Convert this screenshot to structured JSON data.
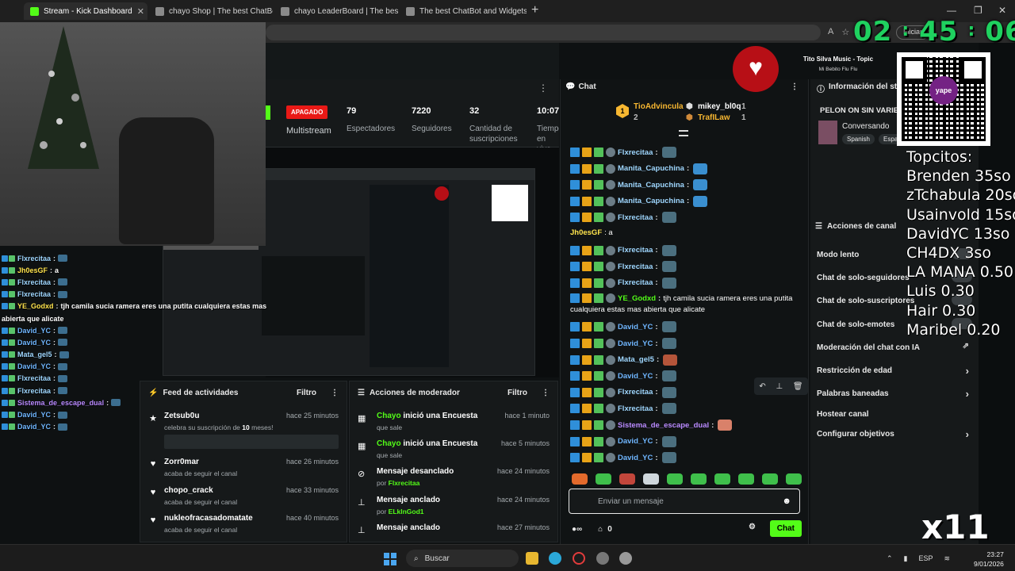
{
  "browser": {
    "tabs": [
      {
        "title": "Stream - Kick Dashboard",
        "active": true
      },
      {
        "title": "chayo Shop | The best ChatBot an"
      },
      {
        "title": "chayo LeaderBoard | The best Chat"
      },
      {
        "title": "The best ChatBot and Widgets for"
      }
    ],
    "signin_label": "Iniciar"
  },
  "clock": {
    "h": "02",
    "m": "45",
    "s": "06"
  },
  "stats": {
    "status": "APAGADO",
    "multistream": "Multistream",
    "items": [
      {
        "value": "79",
        "label": "Espectadores"
      },
      {
        "value": "7220",
        "label": "Seguidores"
      },
      {
        "value": "32",
        "label": "Cantidad de suscripciones"
      },
      {
        "value": "10:07",
        "label": "Tiempo en vivo"
      }
    ]
  },
  "overlay_chat": [
    {
      "user": "Flxrecitaa",
      "color": "#9fd7ff",
      "msg": ""
    },
    {
      "user": "Jh0esGF",
      "color": "#ffe44d",
      "msg": "a"
    },
    {
      "user": "Flxrecitaa",
      "color": "#9fd7ff",
      "msg": ""
    },
    {
      "user": "Flxrecitaa",
      "color": "#9fd7ff",
      "msg": ""
    },
    {
      "user": "YE_Godxd",
      "color": "#ffe44d",
      "msg": "tjh camila sucia ramera eres una putita cualquiera estas mas"
    },
    {
      "user": "",
      "color": "#fff",
      "msg": "abierta que alicate"
    },
    {
      "user": "David_YC",
      "color": "#6fb6ff",
      "msg": ""
    },
    {
      "user": "David_YC",
      "color": "#6fb6ff",
      "msg": ""
    },
    {
      "user": "Mata_gel5",
      "color": "#9fd7ff",
      "msg": ""
    },
    {
      "user": "David_YC",
      "color": "#6fb6ff",
      "msg": ""
    },
    {
      "user": "Flxrecitaa",
      "color": "#9fd7ff",
      "msg": ""
    },
    {
      "user": "Flxrecitaa",
      "color": "#9fd7ff",
      "msg": ""
    },
    {
      "user": "Sistema_de_escape_dual",
      "color": "#b98aff",
      "msg": ""
    },
    {
      "user": "David_YC",
      "color": "#6fb6ff",
      "msg": ""
    },
    {
      "user": "David_YC",
      "color": "#6fb6ff",
      "msg": ""
    }
  ],
  "activity": {
    "title": "Feed de actividades",
    "filter": "Filtro",
    "items": [
      {
        "user": "Zetsub0u",
        "time": "hace 25 minutos",
        "desc_pre": "celebra su suscripción de ",
        "desc_num": "10",
        "desc_post": " meses!",
        "icon": "★"
      },
      {
        "user": "Zorr0mar",
        "time": "hace 26 minutos",
        "desc": "acaba de seguir el canal",
        "icon": "♥"
      },
      {
        "user": "chopo_crack",
        "time": "hace 33 minutos",
        "desc": "acaba de seguir el canal",
        "icon": "♥"
      },
      {
        "user": "nukleofracasadomatate",
        "time": "hace 40 minutos",
        "desc": "acaba de seguir el canal",
        "icon": "♥"
      }
    ]
  },
  "modactions": {
    "title": "Acciones de moderador",
    "filter": "Filtro",
    "items": [
      {
        "who": "Chayo",
        "action": " inició una Encuesta",
        "time": "hace 1 minuto",
        "sub": "que sale",
        "by": ""
      },
      {
        "who": "Chayo",
        "action": " inició una Encuesta",
        "time": "hace 5 minutos",
        "sub": "que sale",
        "by": ""
      },
      {
        "who": "",
        "action": "Mensaje desanclado",
        "time": "hace 24 minutos",
        "sub": "por ",
        "by": "Flxrecitaa"
      },
      {
        "who": "",
        "action": "Mensaje anclado",
        "time": "hace 24 minutos",
        "sub": "por ",
        "by": "ELkInGod1"
      },
      {
        "who": "",
        "action": "Mensaje anclado",
        "time": "hace 27 minutos",
        "sub": "",
        "by": ""
      }
    ]
  },
  "chat": {
    "title": "Chat",
    "podium": {
      "first": {
        "name": "TioAdvincula",
        "rank": "1",
        "count": "2"
      },
      "second": {
        "name": "mikey_bl0q",
        "count": "1"
      },
      "third": {
        "name": "TrafILaw",
        "count": "1"
      }
    },
    "messages": [
      {
        "user": "Flxrecitaa",
        "color": "#9fd7ff",
        "text": "",
        "emote": "#4b6f7f",
        "badges": true
      },
      {
        "user": "Manita_Capuchina",
        "color": "#9fd7ff",
        "text": "",
        "emote": "#3a8fd0",
        "badges": true
      },
      {
        "user": "Manita_Capuchina",
        "color": "#9fd7ff",
        "text": "",
        "emote": "#3a8fd0",
        "badges": true
      },
      {
        "user": "Manita_Capuchina",
        "color": "#9fd7ff",
        "text": "",
        "emote": "#3a8fd0",
        "badges": true
      },
      {
        "user": "Flxrecitaa",
        "color": "#9fd7ff",
        "text": "",
        "emote": "#4b6f7f",
        "badges": true
      },
      {
        "user": "Jh0esGF",
        "color": "#ffe44d",
        "text": ": a",
        "emote": "",
        "badges": false
      },
      {
        "user": "Flxrecitaa",
        "color": "#9fd7ff",
        "text": "",
        "emote": "#4b6f7f",
        "badges": true
      },
      {
        "user": "Flxrecitaa",
        "color": "#9fd7ff",
        "text": "",
        "emote": "#4b6f7f",
        "badges": true
      },
      {
        "user": "Flxrecitaa",
        "color": "#9fd7ff",
        "text": "",
        "emote": "#4b6f7f",
        "badges": true
      },
      {
        "user": "YE_Godxd",
        "color": "#53fc18",
        "text": "tjh camila sucia ramera eres una putita",
        "emote": "",
        "badges": true
      },
      {
        "user": "",
        "color": "#fff",
        "text": "cualquiera estas mas abierta que alicate",
        "emote": "",
        "badges": false
      },
      {
        "user": "David_YC",
        "color": "#6fb6ff",
        "text": "",
        "emote": "#4b6f7f",
        "badges": true
      },
      {
        "user": "David_YC",
        "color": "#6fb6ff",
        "text": "",
        "emote": "#4b6f7f",
        "badges": true
      },
      {
        "user": "Mata_gel5",
        "color": "#9fd7ff",
        "text": "",
        "emote": "#b5553a",
        "badges": true
      },
      {
        "user": "David_YC",
        "color": "#6fb6ff",
        "text": "",
        "emote": "#4b6f7f",
        "badges": true
      },
      {
        "user": "Flxrecitaa",
        "color": "#9fd7ff",
        "text": "",
        "emote": "#4b6f7f",
        "badges": true
      },
      {
        "user": "Flxrecitaa",
        "color": "#9fd7ff",
        "text": "",
        "emote": "#4b6f7f",
        "badges": true
      },
      {
        "user": "Sistema_de_escape_dual",
        "color": "#b98aff",
        "text": "",
        "emote": "#d9816a",
        "badges": true
      },
      {
        "user": "David_YC",
        "color": "#6fb6ff",
        "text": "",
        "emote": "#4b6f7f",
        "badges": true
      },
      {
        "user": "David_YC",
        "color": "#6fb6ff",
        "text": "",
        "emote": "#4b6f7f",
        "badges": true
      }
    ],
    "input_placeholder": "Enviar un mensaje",
    "viewers_count": "0",
    "send_label": "Chat"
  },
  "channel_info": {
    "title": "Información del stre",
    "stream_title": "PELON ON SIN VARIE",
    "category": "Conversando",
    "tags": [
      "Spanish",
      "Espa"
    ]
  },
  "channel_actions": {
    "title": "Acciones de canal",
    "items": [
      {
        "label": "Modo lento",
        "kind": "toggle"
      },
      {
        "label": "Chat de solo-seguidores",
        "kind": "toggle"
      },
      {
        "label": "Chat de solo-suscriptores",
        "kind": "toggle"
      },
      {
        "label": "Chat de solo-emotes",
        "kind": "toggle"
      },
      {
        "label": "Moderación del chat con IA",
        "kind": "external"
      },
      {
        "label": "Restricción de edad",
        "kind": "chevron"
      },
      {
        "label": "Palabras baneadas",
        "kind": "chevron"
      },
      {
        "label": "Hostear canal",
        "kind": "none"
      },
      {
        "label": "Configurar objetivos",
        "kind": "chevron"
      }
    ]
  },
  "song": {
    "title": "Tito Silva Music - Topic",
    "subtitle": "Mi Bebito Flu Flu"
  },
  "qr_label": "yape",
  "topcitos": [
    "Topcitos:",
    "Brenden 35so",
    "zTchabula 20so",
    "Usainvold 15so",
    "DavidYC 13so",
    "CH4DX 3so",
    "LA MANA 0.50",
    "Luis 0.30",
    "Hair 0.30",
    "Maribel 0.20"
  ],
  "multiplier": "x11",
  "taskbar": {
    "search": "Buscar",
    "lang": "ESP",
    "time": "23:27",
    "date": "9/01/2026"
  }
}
